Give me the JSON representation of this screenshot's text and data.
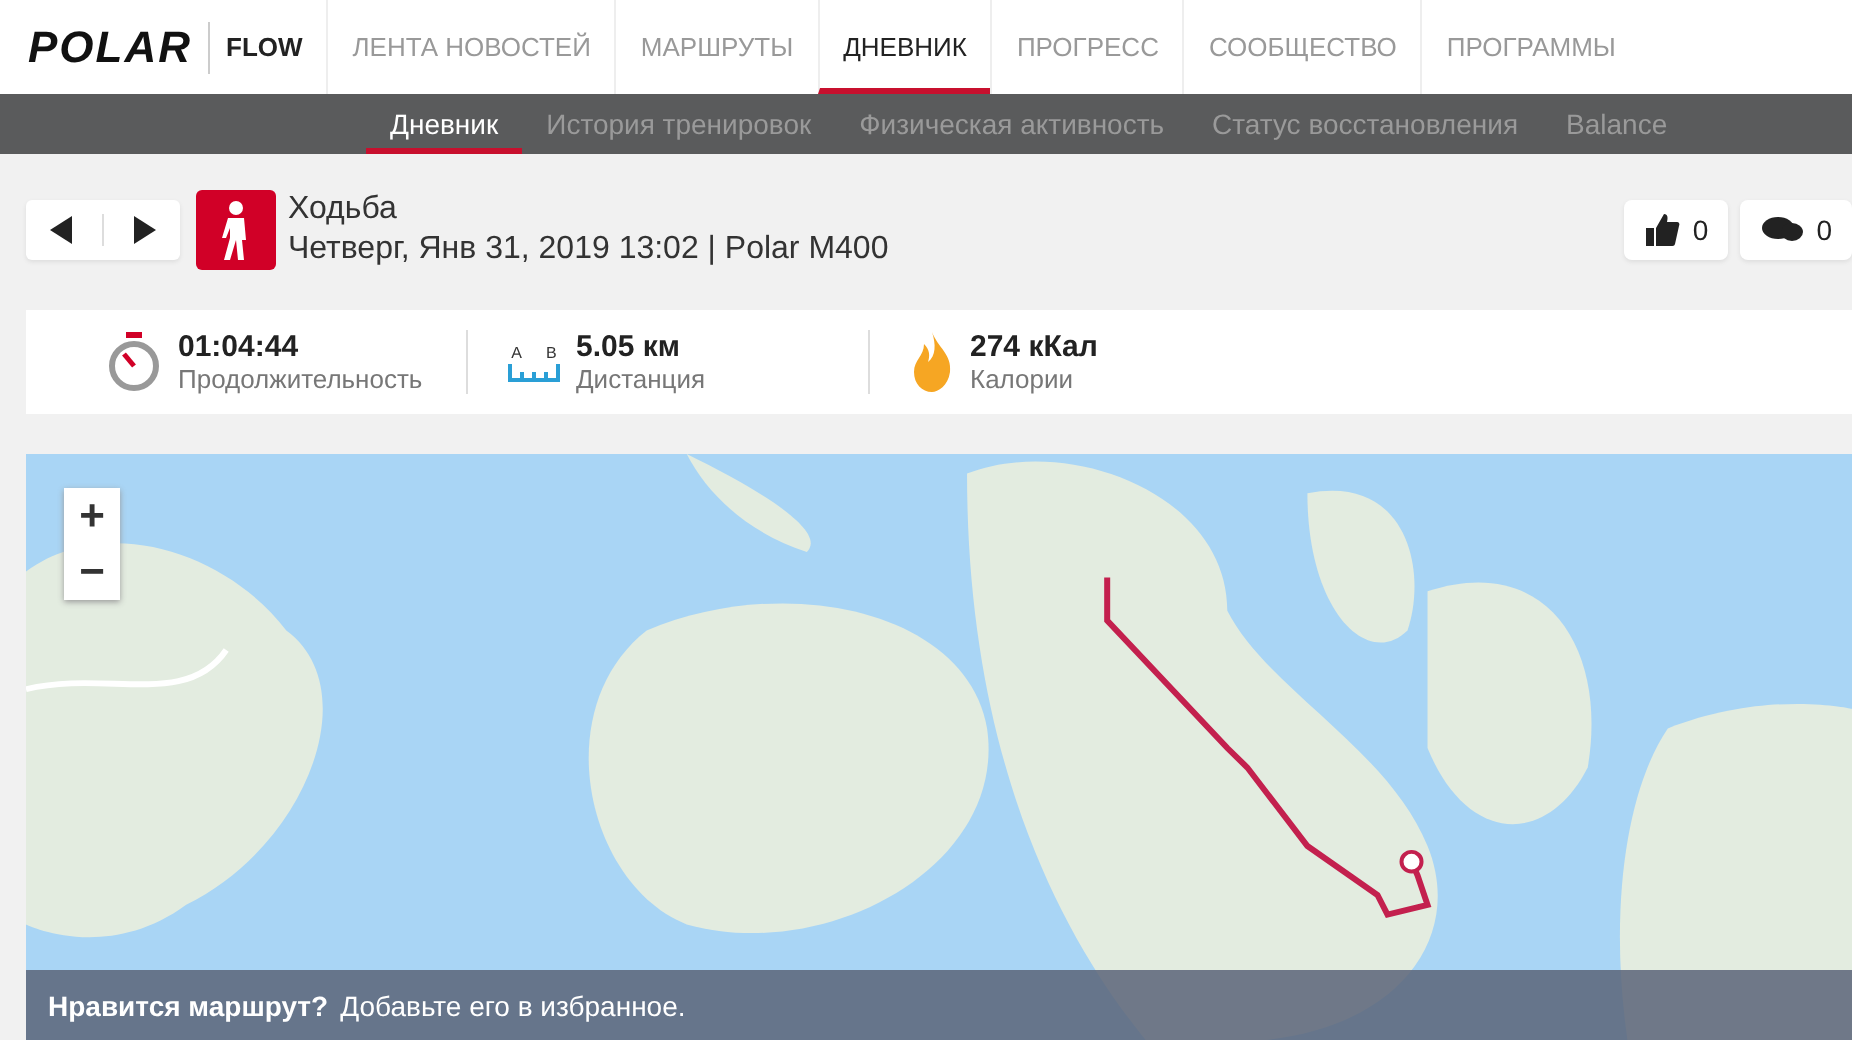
{
  "brand": {
    "logo": "POLAR",
    "product": "FLOW"
  },
  "nav": [
    {
      "label": "ЛЕНТА НОВОСТЕЙ",
      "selected": false
    },
    {
      "label": "МАРШРУТЫ",
      "selected": false
    },
    {
      "label": "ДНЕВНИК",
      "selected": true
    },
    {
      "label": "ПРОГРЕСС",
      "selected": false
    },
    {
      "label": "СООБЩЕСТВО",
      "selected": false
    },
    {
      "label": "ПРОГРАММЫ",
      "selected": false
    }
  ],
  "subnav": [
    {
      "label": "Дневник",
      "selected": true
    },
    {
      "label": "История тренировок",
      "selected": false
    },
    {
      "label": "Физическая активность",
      "selected": false
    },
    {
      "label": "Статус восстановления",
      "selected": false
    },
    {
      "label": "Balance",
      "selected": false
    }
  ],
  "session": {
    "sport": "Ходьба",
    "details": "Четверг, Янв 31, 2019 13:02 | Polar M400",
    "likes": "0",
    "comments": "0"
  },
  "stats": [
    {
      "kind": "duration",
      "value": "01:04:44",
      "label": "Продолжительность"
    },
    {
      "kind": "distance",
      "value": "5.05 км",
      "label": "Дистанция",
      "from": "A",
      "to": "B"
    },
    {
      "kind": "calories",
      "value": "274 кКал",
      "label": "Калории"
    }
  ],
  "map": {
    "zoom_in": "+",
    "zoom_out": "−",
    "banner": {
      "question": "Нравится маршрут?",
      "text": "Добавьте его в избранное."
    }
  }
}
